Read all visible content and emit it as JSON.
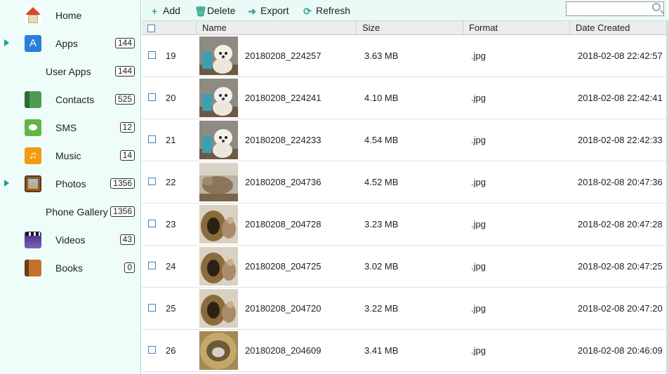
{
  "sidebar": {
    "items": [
      {
        "label": "Home",
        "count": null,
        "expandable": false
      },
      {
        "label": "Apps",
        "count": "144",
        "expandable": true
      },
      {
        "label": "User Apps",
        "count": "144",
        "expandable": false,
        "sub": true
      },
      {
        "label": "Contacts",
        "count": "525",
        "expandable": false
      },
      {
        "label": "SMS",
        "count": "12",
        "expandable": false
      },
      {
        "label": "Music",
        "count": "14",
        "expandable": false
      },
      {
        "label": "Photos",
        "count": "1356",
        "expandable": true
      },
      {
        "label": "Phone Gallery",
        "count": "1356",
        "expandable": false,
        "sub": true
      },
      {
        "label": "Videos",
        "count": "43",
        "expandable": false
      },
      {
        "label": "Books",
        "count": "0",
        "expandable": false
      }
    ]
  },
  "toolbar": {
    "add_label": "Add",
    "delete_label": "Delete",
    "export_label": "Export",
    "refresh_label": "Refresh",
    "search_value": ""
  },
  "table": {
    "columns": {
      "name": "Name",
      "size": "Size",
      "format": "Format",
      "date": "Date Created"
    },
    "rows": [
      {
        "num": "19",
        "name": "20180208_224257",
        "size": "3.63 MB",
        "format": ".jpg",
        "date": "2018-02-08 22:42:57",
        "thumb": "dog"
      },
      {
        "num": "20",
        "name": "20180208_224241",
        "size": "4.10 MB",
        "format": ".jpg",
        "date": "2018-02-08 22:42:41",
        "thumb": "dog"
      },
      {
        "num": "21",
        "name": "20180208_224233",
        "size": "4.54 MB",
        "format": ".jpg",
        "date": "2018-02-08 22:42:33",
        "thumb": "dog"
      },
      {
        "num": "22",
        "name": "20180208_204736",
        "size": "4.52 MB",
        "format": ".jpg",
        "date": "2018-02-08 20:47:36",
        "thumb": "rabbit"
      },
      {
        "num": "23",
        "name": "20180208_204728",
        "size": "3.23 MB",
        "format": ".jpg",
        "date": "2018-02-08 20:47:28",
        "thumb": "tunnel"
      },
      {
        "num": "24",
        "name": "20180208_204725",
        "size": "3.02 MB",
        "format": ".jpg",
        "date": "2018-02-08 20:47:25",
        "thumb": "tunnel"
      },
      {
        "num": "25",
        "name": "20180208_204720",
        "size": "3.22 MB",
        "format": ".jpg",
        "date": "2018-02-08 20:47:20",
        "thumb": "tunnel"
      },
      {
        "num": "26",
        "name": "20180208_204609",
        "size": "3.41 MB",
        "format": ".jpg",
        "date": "2018-02-08 20:46:09",
        "thumb": "basket"
      }
    ]
  },
  "colors": {
    "accent": "#1e9e8f",
    "sidebar_bg": "#eefcfa",
    "toolbar_bg": "#e9faf7"
  }
}
